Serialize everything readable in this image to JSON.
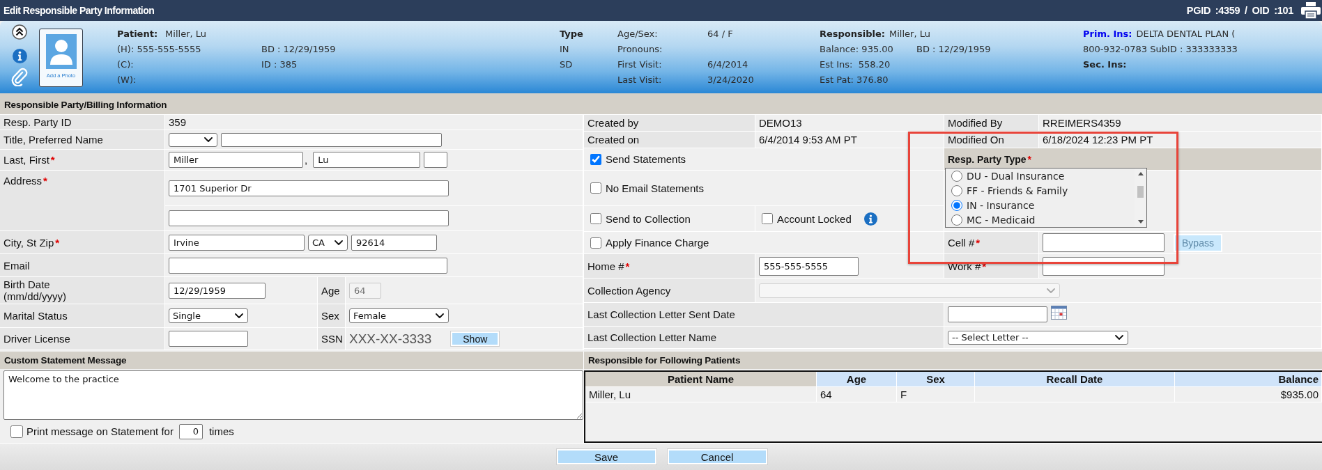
{
  "window": {
    "title": "Edit Responsible Party Information",
    "ids": "PGID :4359 / OID :101"
  },
  "patient_header": {
    "photo_caption": "Add a Photo",
    "patient": {
      "label": "Patient:",
      "value": "Miller, Lu"
    },
    "phones": [
      "(H): 555-555-5555",
      "(C):",
      "(W):"
    ],
    "identity": [
      "BD : 12/29/1959",
      "ID : 385"
    ],
    "type": {
      "label": "Type",
      "values": [
        "IN",
        "SD"
      ]
    },
    "details": [
      {
        "label": "Age/Sex:",
        "value": "64 / F"
      },
      {
        "label": "Pronouns:"
      },
      {
        "label": "First Visit:",
        "value": "6/4/2014"
      },
      {
        "label": "Last Visit:",
        "value": "3/24/2020"
      }
    ],
    "responsible": {
      "label": "Responsible:",
      "value": "Miller, Lu",
      "balance": "Balance: 935.00",
      "birth_date": "BD : 12/29/1959",
      "est_ins": "Est Ins:  558.20",
      "est_pat": "Est Pat: 376.80"
    },
    "insurance": {
      "primary_label": "Prim. Ins:",
      "primary_value": "DELTA DENTAL PLAN (",
      "primary_detail": "800-932-0783 SubID : 333333333",
      "secondary_label": "Sec. Ins:"
    }
  },
  "billing": {
    "title": "Responsible Party/Billing Information",
    "resp_party_id": {
      "label": "Resp. Party ID",
      "value": "359"
    },
    "title_preferred": {
      "label": "Title, Preferred Name"
    },
    "last_first": {
      "label": "Last, First",
      "required_mark": "*",
      "last": "Miller",
      "separator": ",",
      "first": "Lu"
    },
    "address": {
      "label": "Address",
      "required_mark": "*",
      "line1": "1701 Superior Dr"
    },
    "city_st_zip": {
      "label": "City, St Zip",
      "required_mark": "*",
      "city": "Irvine",
      "state": "CA",
      "zip": "92614"
    },
    "email": {
      "label": "Email"
    },
    "birth_date": {
      "label": "Birth Date (mm/dd/yyyy)",
      "value": "12/29/1959"
    },
    "age": {
      "label": "Age",
      "value": "64",
      "disabled": true
    },
    "marital_status": {
      "label": "Marital Status",
      "value": "Single"
    },
    "sex": {
      "label": "Sex",
      "value": "Female"
    },
    "driver_license": {
      "label": "Driver License"
    },
    "ssn": {
      "label": "SSN",
      "value": "XXX-XX-3333",
      "button": "Show"
    },
    "created_by": {
      "label": "Created by",
      "value": "DEMO13"
    },
    "modified_by": {
      "label": "Modified By",
      "value": "RREIMERS4359"
    },
    "created_on": {
      "label": "Created on",
      "value": "6/4/2014 9:53 AM PT"
    },
    "modified_on": {
      "label": "Modified On",
      "value": "6/18/2024 12:23 PM PT"
    },
    "send_statements": {
      "label": "Send Statements",
      "checked": true
    },
    "no_email_statements": {
      "label": "No Email Statements",
      "checked": false
    },
    "send_to_collection": {
      "label": "Send to Collection",
      "checked": false
    },
    "account_locked": {
      "label": "Account Locked",
      "checked": false
    },
    "apply_finance_charge": {
      "label": "Apply Finance Charge",
      "checked": false
    },
    "resp_party_type": {
      "label": "Resp. Party Type",
      "required_mark": "*",
      "options": [
        {
          "label": "DU - Dual Insurance",
          "selected": false
        },
        {
          "label": "FF - Friends & Family",
          "selected": false
        },
        {
          "label": "IN - Insurance",
          "selected": true
        },
        {
          "label": "MC - Medicaid",
          "selected": false
        }
      ]
    },
    "cell_phone": {
      "label": "Cell #",
      "required_mark": "*"
    },
    "bypass_button": {
      "label": "Bypass",
      "disabled": true
    },
    "home_phone": {
      "label": "Home #",
      "required_mark": "*",
      "value": "555-555-5555"
    },
    "work_phone": {
      "label": "Work #",
      "required_mark": "*"
    },
    "collection_agency": {
      "label": "Collection Agency",
      "disabled": true
    },
    "last_letter_sent_date": {
      "label": "Last Collection Letter Sent Date"
    },
    "last_letter_name": {
      "label": "Last Collection Letter Name",
      "value": "-- Select Letter --"
    }
  },
  "custom_message": {
    "title": "Custom Statement Message",
    "message": "Welcome to the practice",
    "print_option": {
      "label": "Print message on Statement for",
      "checked": false,
      "count": "0",
      "suffix": "times"
    }
  },
  "patients": {
    "title": "Responsible for Following Patients",
    "columns": [
      {
        "label": "Patient Name",
        "sorted": true
      },
      {
        "label": "Age",
        "sorted": false
      },
      {
        "label": "Sex",
        "sorted": false
      },
      {
        "label": "Recall Date",
        "sorted": false
      },
      {
        "label": "Balance",
        "sorted": false
      }
    ],
    "rows": [
      {
        "name": "Miller, Lu",
        "age": "64",
        "sex": "F",
        "balance": "$935.00"
      }
    ]
  },
  "buttons": [
    {
      "label": "Save"
    },
    {
      "label": "Cancel"
    }
  ],
  "annotations": [
    {
      "kind": "frame"
    }
  ]
}
